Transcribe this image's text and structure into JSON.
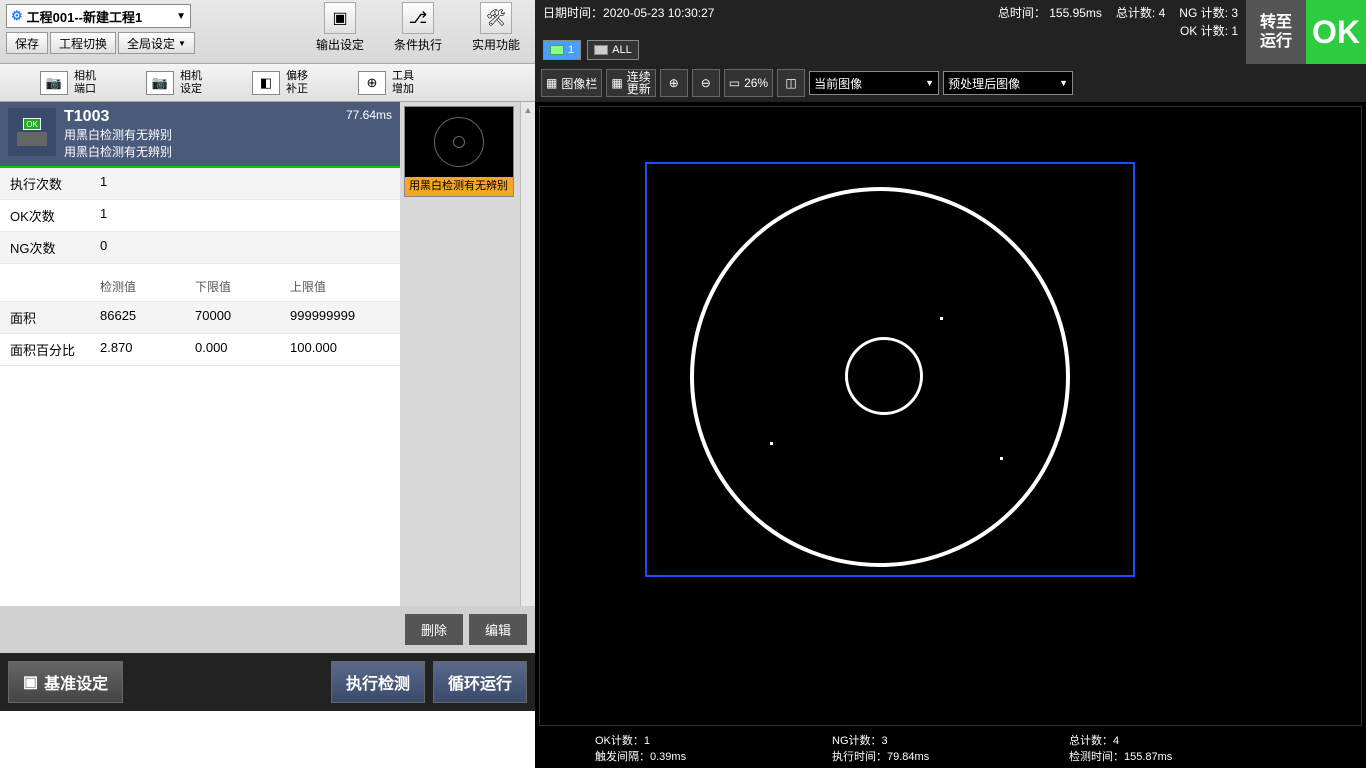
{
  "header": {
    "project_label": "工程001--新建工程1",
    "save": "保存",
    "switch_project": "工程切换",
    "global_settings": "全局设定",
    "tools": {
      "output": "输出设定",
      "condition": "条件执行",
      "utility": "实用功能"
    },
    "datetime_label": "日期时间：",
    "datetime": "2020-05-23 10:30:27",
    "total_time_label": "总时间：",
    "total_time": "155.95ms",
    "total_count_label": "总计数:",
    "total_count": "4",
    "ng_count_label": "NG 计数:",
    "ng_count": "3",
    "ok_count_label": "OK 计数:",
    "ok_count": "1",
    "pill1": "1",
    "pill_all": "ALL",
    "switch_run": "转至\n运行",
    "ok": "OK"
  },
  "cambar": {
    "cam_port_l1": "相机",
    "cam_port_l2": "端口",
    "cam_set_l1": "相机",
    "cam_set_l2": "设定",
    "offset_l1": "偏移",
    "offset_l2": "补正",
    "addtool_l1": "工具",
    "addtool_l2": "增加"
  },
  "imgbar": {
    "image_bar": "图像栏",
    "cont_update": "连续\n更新",
    "zoom_pct": "26%",
    "sel_current": "当前图像",
    "sel_processed": "预处理后图像"
  },
  "tool": {
    "id": "T1003",
    "desc1": "用黑白检测有无辨别",
    "desc2": "用黑白检测有无辨别",
    "time": "77.64ms",
    "thumb_label": "用黑白检测有无辨别"
  },
  "stats": {
    "exec_label": "执行次数",
    "exec_val": "1",
    "ok_label": "OK次数",
    "ok_val": "1",
    "ng_label": "NG次数",
    "ng_val": "0",
    "hdr_detect": "检测值",
    "hdr_lower": "下限值",
    "hdr_upper": "上限值",
    "rows": [
      {
        "name": "面积",
        "v": "86625",
        "lo": "70000",
        "hi": "999999999"
      },
      {
        "name": "面积百分比",
        "v": "2.870",
        "lo": "0.000",
        "hi": "100.000"
      }
    ]
  },
  "buttons": {
    "delete": "删除",
    "edit": "编辑",
    "ref_set": "基准设定",
    "run_detect": "执行检测",
    "loop_run": "循环运行"
  },
  "status": {
    "ok_cnt_l": "OK计数：",
    "ok_cnt": "1",
    "ng_cnt_l": "NG计数：",
    "ng_cnt": "3",
    "tot_cnt_l": "总计数：",
    "tot_cnt": "4",
    "trg_l": "触发间隔：",
    "trg": "0.39ms",
    "exe_l": "执行时间：",
    "exe": "79.84ms",
    "det_l": "检测时间：",
    "det": "155.87ms"
  }
}
